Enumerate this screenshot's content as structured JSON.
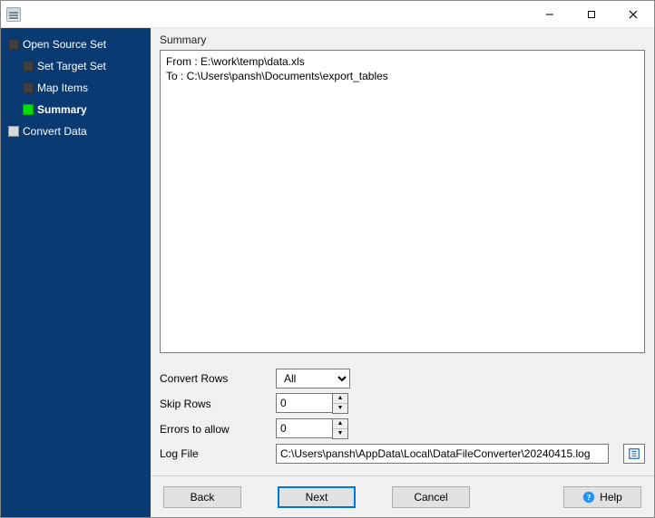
{
  "window": {
    "title": ""
  },
  "sidebar": {
    "items": [
      {
        "label": "Open Source Set",
        "state": "done",
        "child": false
      },
      {
        "label": "Set Target Set",
        "state": "done",
        "child": true
      },
      {
        "label": "Map Items",
        "state": "done",
        "child": true
      },
      {
        "label": "Summary",
        "state": "current",
        "child": true
      },
      {
        "label": "Convert Data",
        "state": "pending",
        "child": false
      }
    ]
  },
  "main": {
    "section_title": "Summary",
    "summary_text": "From : E:\\work\\temp\\data.xls\nTo : C:\\Users\\pansh\\Documents\\export_tables",
    "fields": {
      "convert_rows_label": "Convert Rows",
      "convert_rows_value": "All",
      "convert_rows_options": [
        "All"
      ],
      "skip_rows_label": "Skip Rows",
      "skip_rows_value": "0",
      "errors_label": "Errors to allow",
      "errors_value": "0",
      "log_file_label": "Log File",
      "log_file_value": "C:\\Users\\pansh\\AppData\\Local\\DataFileConverter\\20240415.log"
    }
  },
  "buttons": {
    "back": "Back",
    "next": "Next",
    "cancel": "Cancel",
    "help": "Help"
  },
  "icons": {
    "browse": "browse-icon",
    "help": "help-icon"
  }
}
